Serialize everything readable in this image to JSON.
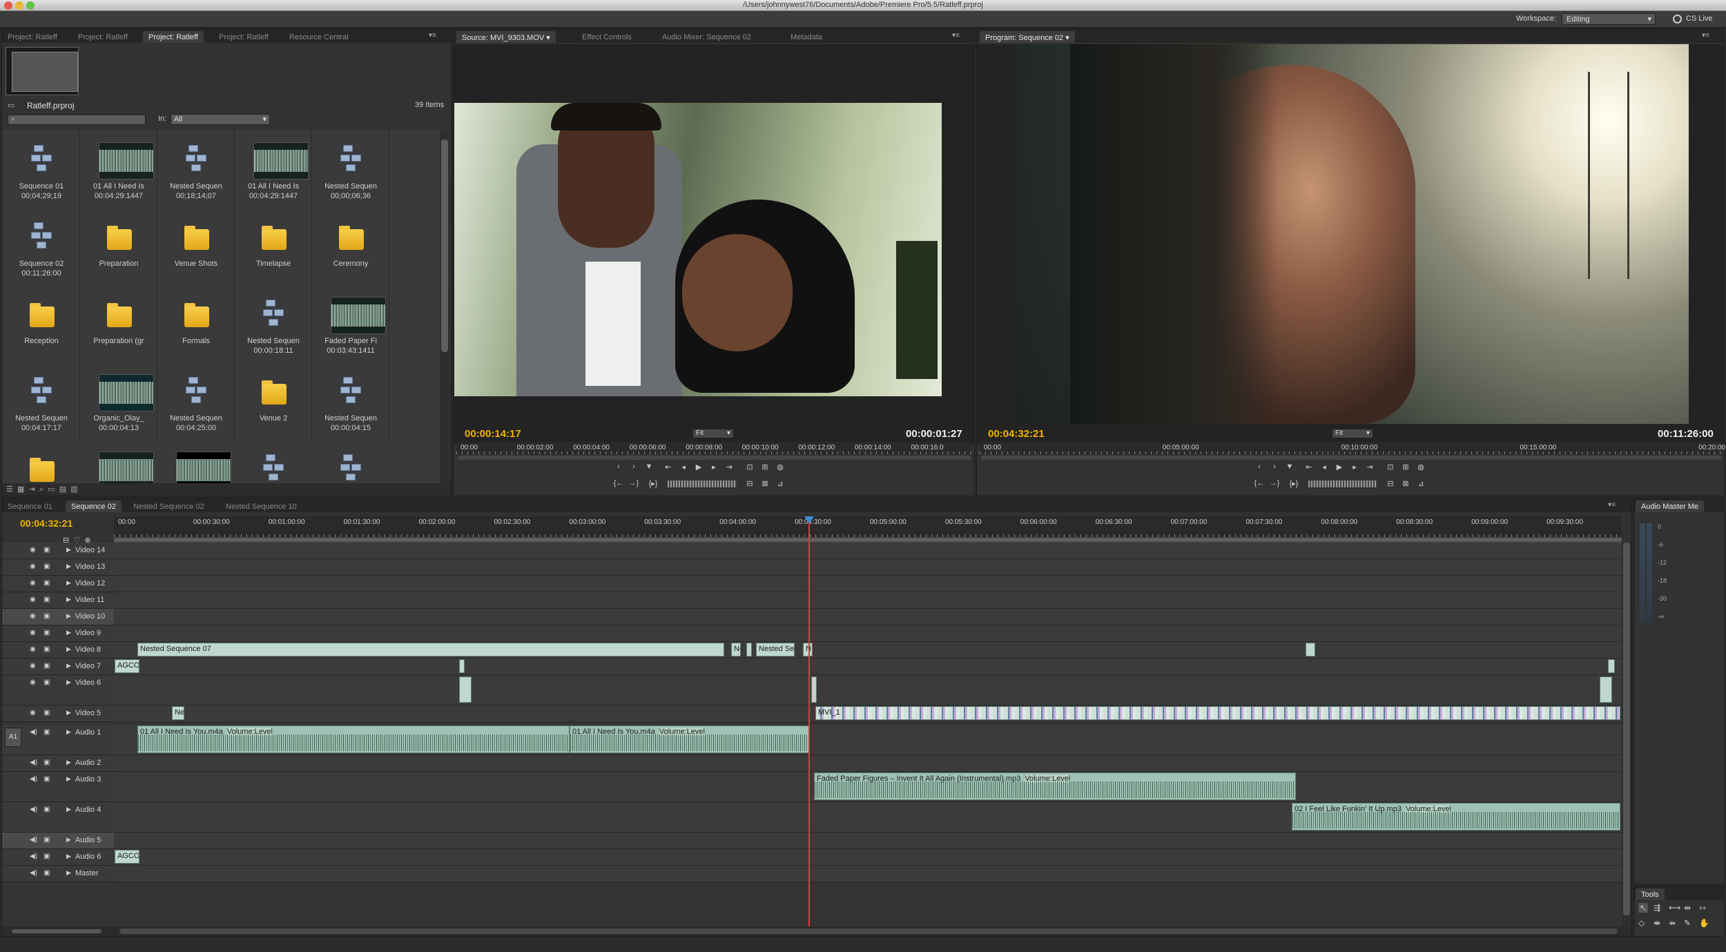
{
  "window": {
    "title": "/Users/johnnywest76/Documents/Adobe/Premiere Pro/5.5/Ratleff.prproj"
  },
  "workspace": {
    "label": "Workspace:",
    "value": "Editing",
    "cslive": "CS Live"
  },
  "project_panel": {
    "tabs": [
      "Project: Ratleff",
      "Project: Ratleff",
      "Project: Ratleff",
      "Project: Ratleff",
      "Resource Central"
    ],
    "active_tab": 2,
    "project_name": "Ratleff.prproj",
    "item_count": "39 Items",
    "search_placeholder": "",
    "in_label": "In:",
    "in_value": "All",
    "items": [
      {
        "label": "Sequence 01",
        "duration": "00;04;29;19",
        "type": "sequence"
      },
      {
        "label": "01 All I Need Is",
        "duration": "00:04:29:1447",
        "type": "audio"
      },
      {
        "label": "Nested Sequen",
        "duration": "00;18;14;07",
        "type": "sequence"
      },
      {
        "label": "01 All I Need Is",
        "duration": "00:04:29:1447",
        "type": "audio"
      },
      {
        "label": "Nested Sequen",
        "duration": "00;00;06;36",
        "type": "sequence"
      },
      {
        "label": "Sequence 02",
        "duration": "00:11:26:00",
        "type": "sequence"
      },
      {
        "label": "Preparation",
        "duration": "",
        "type": "folder"
      },
      {
        "label": "Venue Shots",
        "duration": "",
        "type": "folder"
      },
      {
        "label": "Timelapse",
        "duration": "",
        "type": "folder"
      },
      {
        "label": "Ceremony",
        "duration": "",
        "type": "folder"
      },
      {
        "label": "Reception",
        "duration": "",
        "type": "folder"
      },
      {
        "label": "Preparation (gr",
        "duration": "",
        "type": "folder"
      },
      {
        "label": "Formals",
        "duration": "",
        "type": "folder"
      },
      {
        "label": "Nested Sequen",
        "duration": "00:00:18:11",
        "type": "sequence"
      },
      {
        "label": "Faded Paper Fi",
        "duration": "00:03:43:1411",
        "type": "audio"
      },
      {
        "label": "Nested Sequen",
        "duration": "00:04:17:17",
        "type": "sequence"
      },
      {
        "label": "Organic_Olay_",
        "duration": "00:00:04:13",
        "type": "video"
      },
      {
        "label": "Nested Sequen",
        "duration": "00:04:25:00",
        "type": "sequence"
      },
      {
        "label": "Venue 2",
        "duration": "",
        "type": "folder"
      },
      {
        "label": "Nested Sequen",
        "duration": "00:00:04:15",
        "type": "sequence"
      }
    ]
  },
  "source_monitor": {
    "tabs": [
      "Source: MVI_9303.MOV",
      "Effect Controls",
      "Audio Mixer: Sequence 02",
      "Metadata"
    ],
    "timecode": "00:00:14:17",
    "duration": "00:00:01:27",
    "fit": "Fit",
    "ruler": [
      "00:00",
      "00:00:02:00",
      "00:00:04:00",
      "00:00:06:00",
      "00:00:08:00",
      "00:00:10:00",
      "00:00:12:00",
      "00:00:14:00",
      "00:00:16:0"
    ]
  },
  "program_monitor": {
    "tabs": [
      "Program: Sequence 02"
    ],
    "timecode": "00:04:32:21",
    "duration": "00:11:26:00",
    "fit": "Fit",
    "ruler": [
      "00:00",
      "00:05:00:00",
      "00:10:00:00",
      "00:15:00:00",
      "00:20:00:00"
    ]
  },
  "timeline": {
    "tabs": [
      "Sequence 01",
      "Sequence 02",
      "Nested Sequence 02",
      "Nested Sequence 10"
    ],
    "active_tab": 1,
    "timecode": "00:04:32:21",
    "ruler": [
      "00:00",
      "00:00:30:00",
      "00:01:00:00",
      "00:01:30:00",
      "00:02:00:00",
      "00:02:30:00",
      "00:03:00:00",
      "00:03:30:00",
      "00:04:00:00",
      "00:04:30:00",
      "00:05:00:00",
      "00:05:30:00",
      "00:06:00:00",
      "00:06:30:00",
      "00:07:00:00",
      "00:07:30:00",
      "00:08:00:00",
      "00:08:30:00",
      "00:09:00:00",
      "00:09:30:00"
    ],
    "video_tracks": [
      "Video 14",
      "Video 13",
      "Video 12",
      "Video 11",
      "Video 10",
      "Video 9",
      "Video 8",
      "Video 7",
      "Video 6",
      "Video 5"
    ],
    "audio_tracks": [
      "Audio 1",
      "Audio 2",
      "Audio 3",
      "Audio 4",
      "Audio 5",
      "Audio 6",
      "Master"
    ],
    "a1_label": "A1",
    "clips": {
      "nested07": "Nested Sequence 07",
      "nested_short": "Nested Se",
      "ne1": "Ne",
      "n1": "N",
      "agco_v": "AGCO",
      "agco_a": "AGCO",
      "ne_v5": "Ne",
      "audio1_a": "01 All I Need Is You.m4a",
      "audio1_a_vol": "Volume:Level",
      "audio1_b": "01 All I Need Is You.m4a",
      "audio1_b_vol": "Volume:Level",
      "audio3": "Faded Paper Figures – Invent It All Again (Instrumental).mp3",
      "audio3_vol": "Volume:Level",
      "audio4": "02 I Feel Like Funkin' It Up.mp3",
      "audio4_vol": "Volume:Level",
      "mvi": "MVI_1"
    }
  },
  "audio_master": {
    "title": "Audio Master Me",
    "scale": [
      "0",
      "-6",
      "-12",
      "-18",
      "-30",
      "-∞"
    ]
  },
  "tools": {
    "title": "Tools"
  }
}
